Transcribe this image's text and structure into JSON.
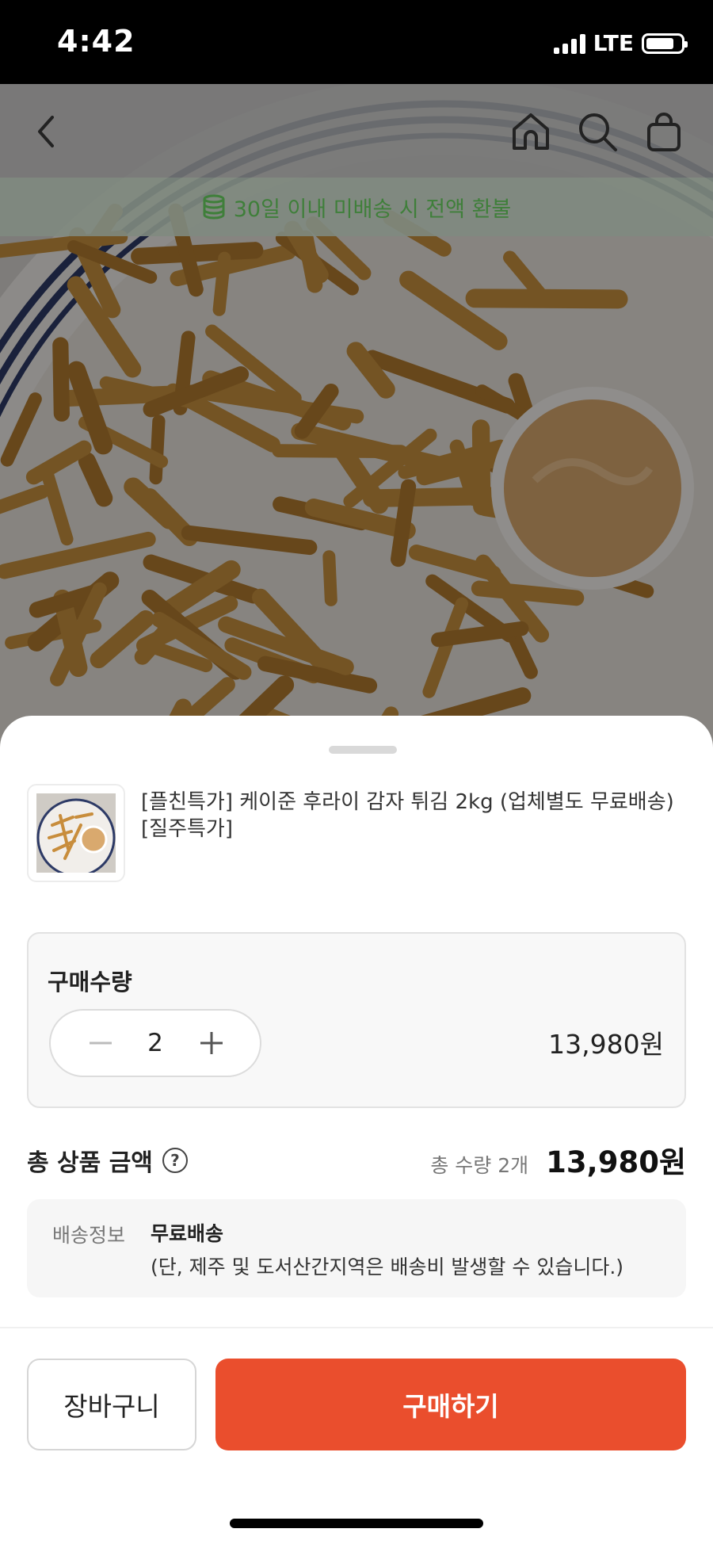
{
  "status_bar": {
    "time": "4:42",
    "network": "LTE",
    "battery_percent": 80
  },
  "header": {
    "icons": [
      "back-arrow-icon",
      "home-icon",
      "search-icon",
      "shopping-bag-icon"
    ],
    "notice": {
      "icon": "coin-stack-icon",
      "text": "30일 이내 미배송 시 전액 환불",
      "color": "#3f7f3a"
    }
  },
  "product": {
    "title": "[플친특가] 케이준 후라이 감자 튀김 2kg (업체별도 무료배송) [질주특가]"
  },
  "quantity": {
    "label": "구매수량",
    "value": "2",
    "line_price": "13,980원"
  },
  "total": {
    "label": "총 상품 금액",
    "help_icon": "?",
    "quantity_text": "총 수량 2개",
    "price": "13,980원"
  },
  "shipping": {
    "key": "배송정보",
    "title": "무료배송",
    "note": "(단, 제주 및 도서산간지역은 배송비 발생할 수 있습니다.)"
  },
  "actions": {
    "cart_label": "장바구니",
    "buy_label": "구매하기",
    "buy_color": "#ea4e2d"
  }
}
